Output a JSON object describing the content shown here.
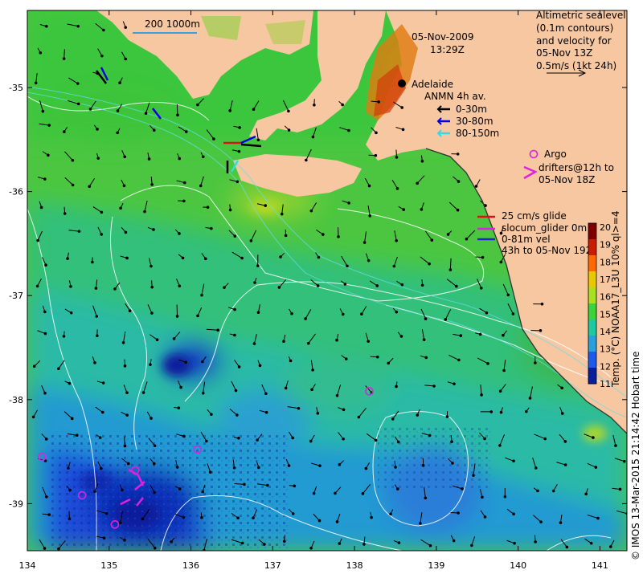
{
  "figure": {
    "date_line1": "05-Nov-2009",
    "date_line2": "13:29Z",
    "city": "Adelaide",
    "scalebar": "200  1000m",
    "credit": "© IMOS 13-Mar-2015 21:14:42 Hobart time"
  },
  "sealevel_legend": {
    "line1": "Altimetric sealevel",
    "line2": "(0.1m contours)",
    "line3": "and velocity for",
    "line4": "05-Nov 13Z",
    "line5": "0.5m/s (1kt 24h)"
  },
  "anmn_legend": {
    "title": "ANMN 4h av.",
    "items": [
      {
        "label": "0-30m",
        "color": "#000000"
      },
      {
        "label": "30-80m",
        "color": "#0000dd"
      },
      {
        "label": "80-150m",
        "color": "#33dddd"
      }
    ]
  },
  "argo_legend": {
    "line1": "Argo",
    "line2": "drifters@12h to",
    "line3": "05-Nov 18Z",
    "color": "#e020e0"
  },
  "glider_legend": {
    "line1": "25 cm/s glide",
    "line2": "slocum_glider 0m",
    "line3": "0-81m vel",
    "line4": "43h to 05-Nov 192",
    "colors": [
      "#dd1111",
      "#e020e0",
      "#2222cc"
    ]
  },
  "colorbar": {
    "label": "Temp. (°C) NOAA17_L3U 10% ql>=4",
    "ticks": [
      "20",
      "19",
      "18",
      "17",
      "16",
      "15",
      "14",
      "13",
      "12",
      "11"
    ],
    "colors": [
      "#800000",
      "#c81e00",
      "#ff6a00",
      "#e8c800",
      "#a8e020",
      "#3cd23c",
      "#1ec8a0",
      "#28a0dc",
      "#1e5aeb",
      "#0a1e9c"
    ]
  },
  "axes": {
    "x_ticks": [
      "134",
      "135",
      "136",
      "137",
      "138",
      "139",
      "140",
      "141"
    ],
    "y_ticks": [
      "-35",
      "-36",
      "-37",
      "-38",
      "-39"
    ]
  },
  "argo_points": [
    {
      "lon": 138.18,
      "lat": -37.92
    },
    {
      "lon": 136.08,
      "lat": -38.48
    },
    {
      "lon": 134.18,
      "lat": -38.55
    },
    {
      "lon": 134.67,
      "lat": -38.92
    },
    {
      "lon": 135.07,
      "lat": -39.2
    },
    {
      "lon": 135.32,
      "lat": -38.68
    }
  ],
  "colors": {
    "land": "#f6c7a0",
    "land_inner": "#e07a10",
    "sst_warm": "#5cc83c",
    "sst_mid": "#2dc89a",
    "sst_cool": "#1e78dc",
    "sst_cold": "#101aa8"
  }
}
